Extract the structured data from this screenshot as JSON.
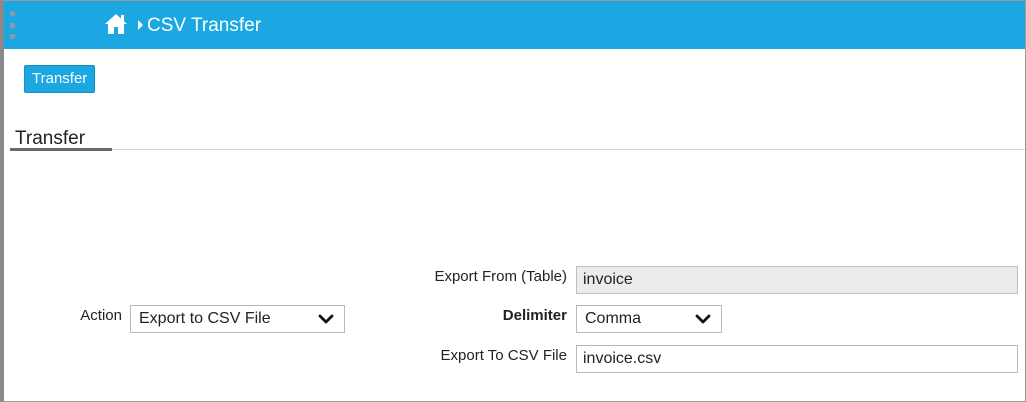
{
  "header": {
    "breadcrumb_title": "CSV Transfer",
    "icons": [
      "kebab-icon",
      "home-icon",
      "chevron-right-icon"
    ]
  },
  "toolbar": {
    "transfer_button": "Transfer"
  },
  "tabs": [
    {
      "label": "Transfer",
      "active": true
    }
  ],
  "form": {
    "action": {
      "label": "Action",
      "value": "Export to CSV File"
    },
    "export_from": {
      "label": "Export From (Table)",
      "value": "invoice"
    },
    "delimiter": {
      "label": "Delimiter",
      "value": "Comma"
    },
    "export_to": {
      "label": "Export To CSV File",
      "value": "invoice.csv"
    }
  },
  "colors": {
    "accent": "#1ba8e2"
  }
}
